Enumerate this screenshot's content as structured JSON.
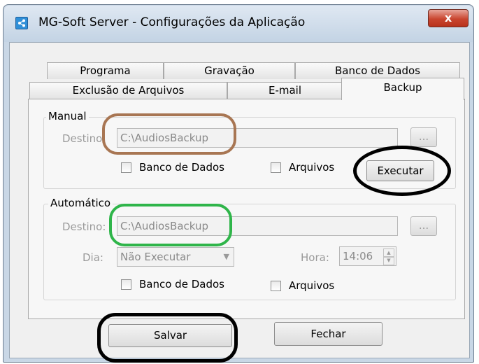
{
  "window": {
    "title": "MG-Soft Server - Configurações da Aplicação",
    "close_symbol": "x"
  },
  "tabs": {
    "row1": [
      "Programa",
      "Gravação",
      "Banco de Dados"
    ],
    "row2": [
      "Exclusão de Arquivos",
      "E-mail",
      "Backup"
    ],
    "active": "Backup"
  },
  "manual": {
    "legend": "Manual",
    "destino_label": "Destino",
    "destino_value": "C:\\AudiosBackup",
    "browse_label": "...",
    "banco_checkbox_label": "Banco de Dados",
    "banco_checked": false,
    "arquivos_checkbox_label": "Arquivos",
    "arquivos_checked": false,
    "executar_label": "Executar"
  },
  "automatico": {
    "legend": "Automático",
    "destino_label": "Destino:",
    "destino_value": "C:\\AudiosBackup",
    "browse_label": "...",
    "dia_label": "Dia:",
    "dia_value": "Não Executar",
    "hora_label": "Hora:",
    "hora_value": "14:06",
    "banco_checkbox_label": "Banco de Dados",
    "banco_checked": false,
    "arquivos_checkbox_label": "Arquivos",
    "arquivos_checked": false
  },
  "footer": {
    "salvar_label": "Salvar",
    "fechar_label": "Fechar"
  },
  "annotations": {
    "manual_destino_color": "#a87653",
    "automatico_destino_color": "#2fb54a",
    "highlight_color": "#000000"
  }
}
